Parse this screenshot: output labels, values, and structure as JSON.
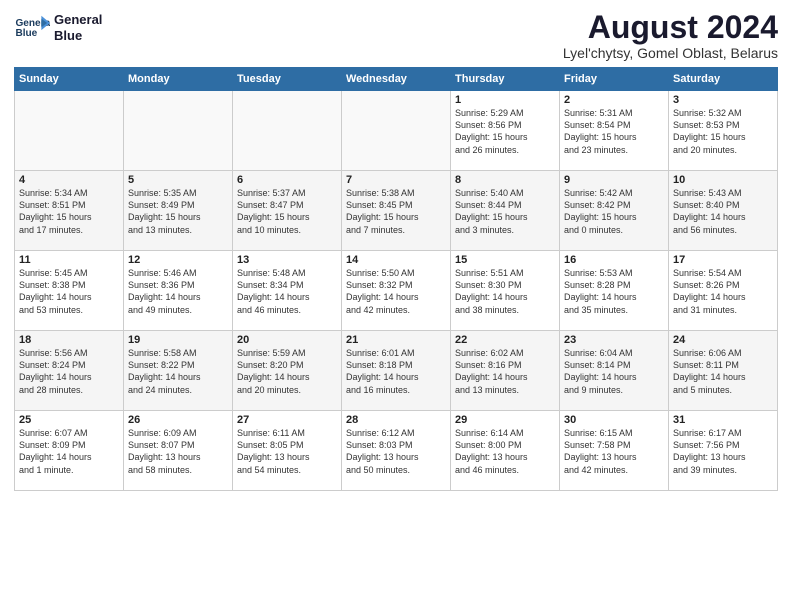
{
  "header": {
    "logo_line1": "General",
    "logo_line2": "Blue",
    "title": "August 2024",
    "subtitle": "Lyel'chytsy, Gomel Oblast, Belarus"
  },
  "columns": [
    "Sunday",
    "Monday",
    "Tuesday",
    "Wednesday",
    "Thursday",
    "Friday",
    "Saturday"
  ],
  "weeks": [
    [
      {
        "day": "",
        "info": ""
      },
      {
        "day": "",
        "info": ""
      },
      {
        "day": "",
        "info": ""
      },
      {
        "day": "",
        "info": ""
      },
      {
        "day": "1",
        "info": "Sunrise: 5:29 AM\nSunset: 8:56 PM\nDaylight: 15 hours\nand 26 minutes."
      },
      {
        "day": "2",
        "info": "Sunrise: 5:31 AM\nSunset: 8:54 PM\nDaylight: 15 hours\nand 23 minutes."
      },
      {
        "day": "3",
        "info": "Sunrise: 5:32 AM\nSunset: 8:53 PM\nDaylight: 15 hours\nand 20 minutes."
      }
    ],
    [
      {
        "day": "4",
        "info": "Sunrise: 5:34 AM\nSunset: 8:51 PM\nDaylight: 15 hours\nand 17 minutes."
      },
      {
        "day": "5",
        "info": "Sunrise: 5:35 AM\nSunset: 8:49 PM\nDaylight: 15 hours\nand 13 minutes."
      },
      {
        "day": "6",
        "info": "Sunrise: 5:37 AM\nSunset: 8:47 PM\nDaylight: 15 hours\nand 10 minutes."
      },
      {
        "day": "7",
        "info": "Sunrise: 5:38 AM\nSunset: 8:45 PM\nDaylight: 15 hours\nand 7 minutes."
      },
      {
        "day": "8",
        "info": "Sunrise: 5:40 AM\nSunset: 8:44 PM\nDaylight: 15 hours\nand 3 minutes."
      },
      {
        "day": "9",
        "info": "Sunrise: 5:42 AM\nSunset: 8:42 PM\nDaylight: 15 hours\nand 0 minutes."
      },
      {
        "day": "10",
        "info": "Sunrise: 5:43 AM\nSunset: 8:40 PM\nDaylight: 14 hours\nand 56 minutes."
      }
    ],
    [
      {
        "day": "11",
        "info": "Sunrise: 5:45 AM\nSunset: 8:38 PM\nDaylight: 14 hours\nand 53 minutes."
      },
      {
        "day": "12",
        "info": "Sunrise: 5:46 AM\nSunset: 8:36 PM\nDaylight: 14 hours\nand 49 minutes."
      },
      {
        "day": "13",
        "info": "Sunrise: 5:48 AM\nSunset: 8:34 PM\nDaylight: 14 hours\nand 46 minutes."
      },
      {
        "day": "14",
        "info": "Sunrise: 5:50 AM\nSunset: 8:32 PM\nDaylight: 14 hours\nand 42 minutes."
      },
      {
        "day": "15",
        "info": "Sunrise: 5:51 AM\nSunset: 8:30 PM\nDaylight: 14 hours\nand 38 minutes."
      },
      {
        "day": "16",
        "info": "Sunrise: 5:53 AM\nSunset: 8:28 PM\nDaylight: 14 hours\nand 35 minutes."
      },
      {
        "day": "17",
        "info": "Sunrise: 5:54 AM\nSunset: 8:26 PM\nDaylight: 14 hours\nand 31 minutes."
      }
    ],
    [
      {
        "day": "18",
        "info": "Sunrise: 5:56 AM\nSunset: 8:24 PM\nDaylight: 14 hours\nand 28 minutes."
      },
      {
        "day": "19",
        "info": "Sunrise: 5:58 AM\nSunset: 8:22 PM\nDaylight: 14 hours\nand 24 minutes."
      },
      {
        "day": "20",
        "info": "Sunrise: 5:59 AM\nSunset: 8:20 PM\nDaylight: 14 hours\nand 20 minutes."
      },
      {
        "day": "21",
        "info": "Sunrise: 6:01 AM\nSunset: 8:18 PM\nDaylight: 14 hours\nand 16 minutes."
      },
      {
        "day": "22",
        "info": "Sunrise: 6:02 AM\nSunset: 8:16 PM\nDaylight: 14 hours\nand 13 minutes."
      },
      {
        "day": "23",
        "info": "Sunrise: 6:04 AM\nSunset: 8:14 PM\nDaylight: 14 hours\nand 9 minutes."
      },
      {
        "day": "24",
        "info": "Sunrise: 6:06 AM\nSunset: 8:11 PM\nDaylight: 14 hours\nand 5 minutes."
      }
    ],
    [
      {
        "day": "25",
        "info": "Sunrise: 6:07 AM\nSunset: 8:09 PM\nDaylight: 14 hours\nand 1 minute."
      },
      {
        "day": "26",
        "info": "Sunrise: 6:09 AM\nSunset: 8:07 PM\nDaylight: 13 hours\nand 58 minutes."
      },
      {
        "day": "27",
        "info": "Sunrise: 6:11 AM\nSunset: 8:05 PM\nDaylight: 13 hours\nand 54 minutes."
      },
      {
        "day": "28",
        "info": "Sunrise: 6:12 AM\nSunset: 8:03 PM\nDaylight: 13 hours\nand 50 minutes."
      },
      {
        "day": "29",
        "info": "Sunrise: 6:14 AM\nSunset: 8:00 PM\nDaylight: 13 hours\nand 46 minutes."
      },
      {
        "day": "30",
        "info": "Sunrise: 6:15 AM\nSunset: 7:58 PM\nDaylight: 13 hours\nand 42 minutes."
      },
      {
        "day": "31",
        "info": "Sunrise: 6:17 AM\nSunset: 7:56 PM\nDaylight: 13 hours\nand 39 minutes."
      }
    ]
  ]
}
